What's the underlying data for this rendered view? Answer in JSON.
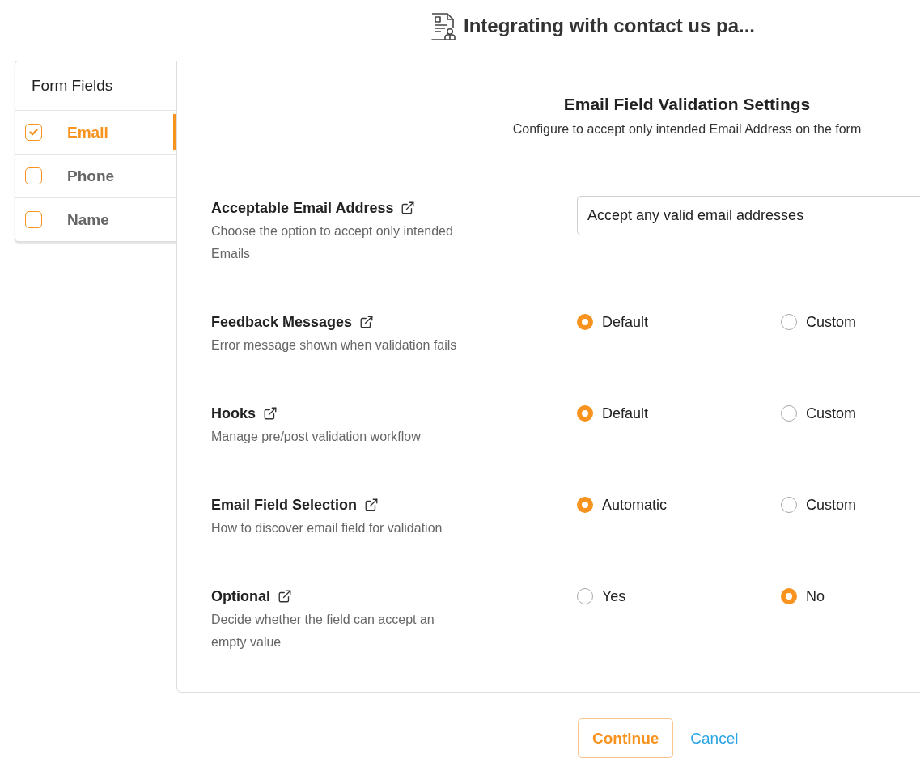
{
  "header": {
    "title": "Integrating with contact us pa..."
  },
  "sidebar": {
    "title": "Form Fields",
    "items": [
      {
        "label": "Email",
        "checked": true,
        "selected": true
      },
      {
        "label": "Phone",
        "checked": false,
        "selected": false
      },
      {
        "label": "Name",
        "checked": false,
        "selected": false
      }
    ]
  },
  "panel": {
    "title": "Email Field Validation Settings",
    "subtitle": "Configure to accept only intended Email Address on the form",
    "settings": [
      {
        "kind": "input",
        "label": "Acceptable Email Address",
        "description": "Choose the option to accept only intended Emails",
        "value": "Accept any valid email addresses"
      },
      {
        "kind": "radio",
        "label": "Feedback Messages",
        "description": "Error message shown when validation fails",
        "options": [
          {
            "label": "Default",
            "selected": true
          },
          {
            "label": "Custom",
            "selected": false
          }
        ]
      },
      {
        "kind": "radio",
        "label": "Hooks",
        "description": "Manage pre/post validation workflow",
        "options": [
          {
            "label": "Default",
            "selected": true
          },
          {
            "label": "Custom",
            "selected": false
          }
        ]
      },
      {
        "kind": "radio",
        "label": "Email Field Selection",
        "description": "How to discover email field for validation",
        "options": [
          {
            "label": "Automatic",
            "selected": true
          },
          {
            "label": "Custom",
            "selected": false
          }
        ]
      },
      {
        "kind": "radio",
        "label": "Optional",
        "description": "Decide whether the field can accept an empty value",
        "options": [
          {
            "label": "Yes",
            "selected": false
          },
          {
            "label": "No",
            "selected": true
          }
        ]
      }
    ]
  },
  "footer": {
    "buttons": [
      {
        "label": "Continue",
        "kind": "outline"
      },
      {
        "label": "Cancel",
        "kind": "link"
      }
    ]
  }
}
